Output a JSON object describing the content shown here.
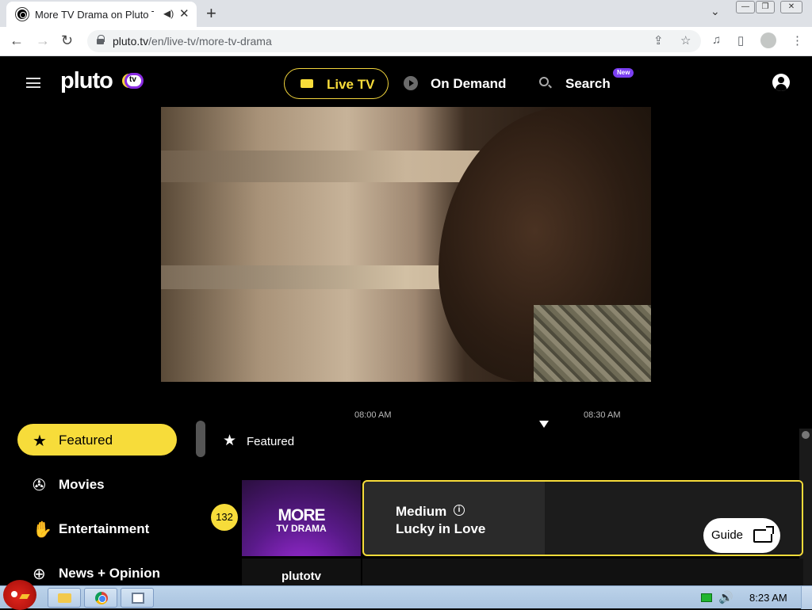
{
  "browser": {
    "tab": {
      "title": "More TV Drama on Pluto TV",
      "audio_icon": "speaker-icon",
      "close": "✕"
    },
    "new_tab": "+",
    "tab_search": "⌄",
    "window_controls": {
      "minimize": "—",
      "restore": "❐",
      "close": "✕"
    },
    "address": {
      "host": "pluto.tv",
      "path": "/en/live-tv/more-tv-drama"
    },
    "nav": {
      "back": "←",
      "forward": "→",
      "reload": "↻"
    },
    "toolbar_icons": {
      "share": "⇪",
      "bookmark": "☆",
      "media": "♫",
      "sidepanel": "▯",
      "menu": "⋮"
    }
  },
  "header": {
    "logo": "pluto",
    "logo_tv": "tv",
    "nav": [
      {
        "label": "Live TV",
        "icon": "tv-icon",
        "active": true
      },
      {
        "label": "On Demand",
        "icon": "play-circle-icon"
      },
      {
        "label": "Search",
        "icon": "search-icon",
        "badge": "New"
      }
    ]
  },
  "timeline": {
    "times": [
      "08:00 AM",
      "08:30 AM"
    ]
  },
  "sidebar": {
    "items": [
      {
        "label": "Featured",
        "icon": "star-icon",
        "glyph": "★",
        "active": true
      },
      {
        "label": "Movies",
        "icon": "film-reel-icon",
        "glyph": "✇"
      },
      {
        "label": "Entertainment",
        "icon": "clapping-hands-icon",
        "glyph": "✋"
      },
      {
        "label": "News + Opinion",
        "icon": "globe-icon",
        "glyph": "⊕"
      }
    ]
  },
  "guide": {
    "heading": "Featured",
    "heading_glyph": "★",
    "channel": {
      "number": "132",
      "logo_main": "MORE",
      "logo_sub": "TV DRAMA",
      "program_title": "Medium",
      "program_episode": "Lucky in Love"
    },
    "channel2": {
      "logo": "plutotv"
    },
    "guide_button": "Guide"
  },
  "taskbar": {
    "clock": "8:23 AM",
    "volume_glyph": "🔊"
  },
  "colors": {
    "accent": "#f7dc3a",
    "badge": "#7b3ff2",
    "background": "#000000"
  }
}
